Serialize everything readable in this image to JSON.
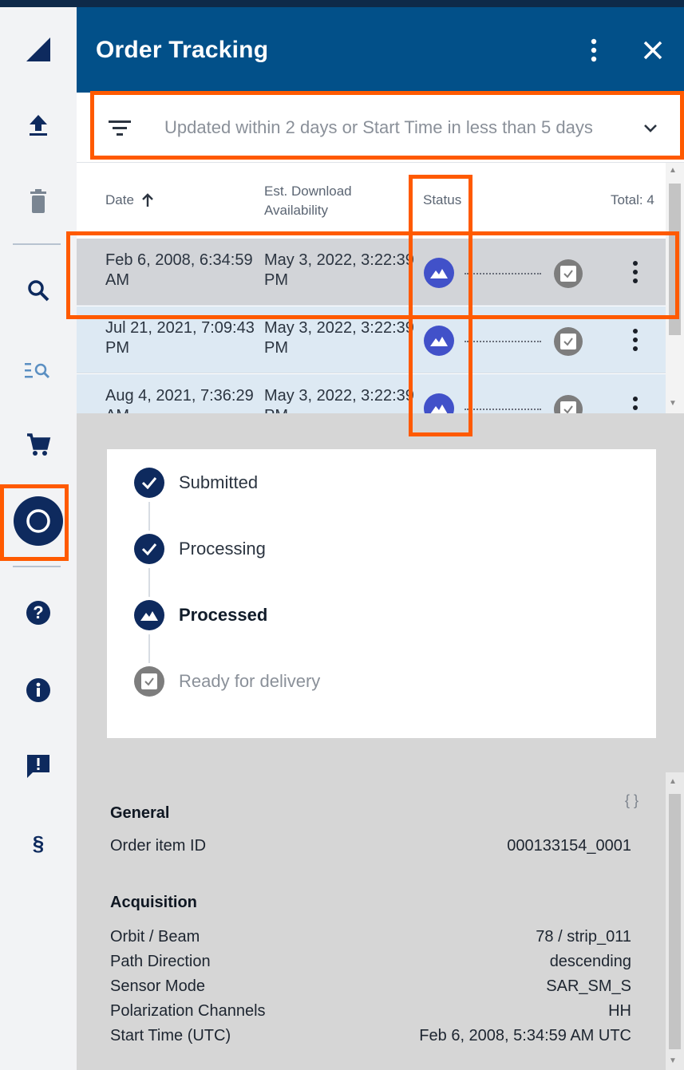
{
  "panel": {
    "title": "Order Tracking"
  },
  "filter": {
    "text": "Updated within 2 days or Start Time in less than 5 days"
  },
  "table": {
    "headers": {
      "date": "Date",
      "est_line1": "Est. Download",
      "est_line2": "Availability",
      "status": "Status",
      "total": "Total: 4"
    },
    "rows": [
      {
        "date_l1": "Feb 6, 2008, 6:34:59",
        "date_l2": "AM",
        "avail_l1": "May 3, 2022, 3:22:39",
        "avail_l2": "PM"
      },
      {
        "date_l1": "Jul 21, 2021, 7:09:43",
        "date_l2": "PM",
        "avail_l1": "May 3, 2022, 3:22:39",
        "avail_l2": "PM"
      },
      {
        "date_l1": "Aug 4, 2021, 7:36:29",
        "date_l2": "AM",
        "avail_l1": "May 3, 2022, 3:22:39",
        "avail_l2": "PM"
      }
    ]
  },
  "timeline": {
    "steps": [
      {
        "label": "Submitted",
        "icon": "check-icon"
      },
      {
        "label": "Processing",
        "icon": "check-icon"
      },
      {
        "label": "Processed",
        "icon": "mountain-icon"
      },
      {
        "label": "Ready for delivery",
        "icon": "checkbox-icon"
      }
    ]
  },
  "details": {
    "braces": "{ }",
    "general_title": "General",
    "order_item_label": "Order item ID",
    "order_item_value": "000133154_0001",
    "acquisition_title": "Acquisition",
    "rows": [
      {
        "label": "Orbit / Beam",
        "value": "78 / strip_011"
      },
      {
        "label": "Path Direction",
        "value": "descending"
      },
      {
        "label": "Sensor Mode",
        "value": "SAR_SM_S"
      },
      {
        "label": "Polarization Channels",
        "value": "HH"
      },
      {
        "label": "Start Time (UTC)",
        "value": "Feb 6, 2008, 5:34:59 AM UTC"
      }
    ]
  },
  "colors": {
    "header": "#025089",
    "navy": "#0e2a5e",
    "status_blue": "#4151c9",
    "highlight": "#ff5a00"
  },
  "sidebar_icons": [
    "collapse-icon",
    "upload-icon",
    "trash-icon",
    "search-icon",
    "list-search-icon",
    "cart-icon",
    "order-tracking-icon",
    "help-icon",
    "info-icon",
    "feedback-icon",
    "legal-icon"
  ]
}
